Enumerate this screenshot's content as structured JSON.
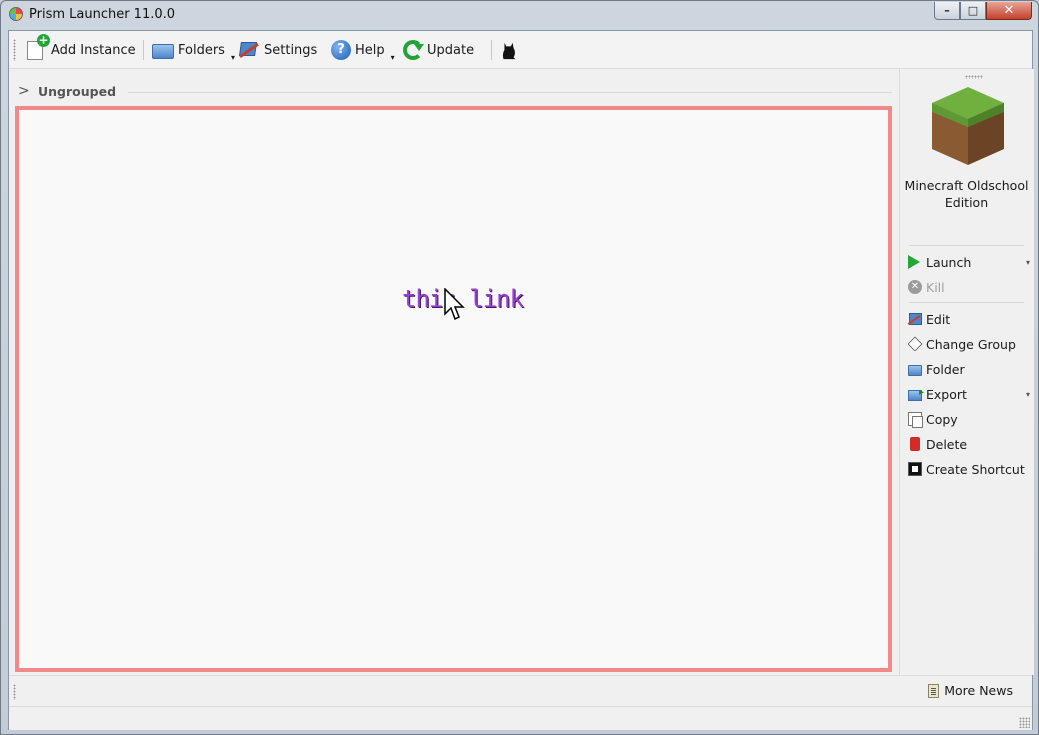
{
  "window": {
    "title": "Prism Launcher 11.0.0",
    "controls": {
      "minimize": "–",
      "maximize": "□",
      "close": "✕"
    }
  },
  "toolbar": {
    "add_instance": "Add Instance",
    "folders": "Folders",
    "settings": "Settings",
    "help": "Help",
    "update": "Update"
  },
  "instances": {
    "group_name": "Ungrouped",
    "overlay_text": "this link",
    "highlight_color": "#f08a8a"
  },
  "sidebar": {
    "instance_name": "Minecraft Oldschool Edition",
    "actions": {
      "launch": "Launch",
      "kill": "Kill",
      "edit": "Edit",
      "change_group": "Change Group",
      "folder": "Folder",
      "export": "Export",
      "copy": "Copy",
      "delete": "Delete",
      "create_shortcut": "Create Shortcut"
    }
  },
  "news": {
    "more_news": "More News"
  },
  "colors": {
    "accent_green": "#21a637",
    "link_purple": "#9a3fd4"
  }
}
